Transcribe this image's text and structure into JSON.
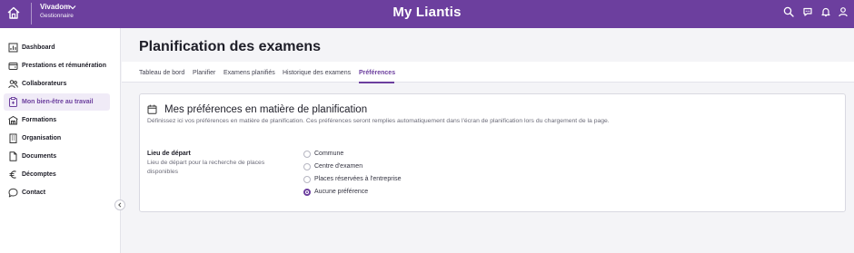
{
  "header": {
    "company": "Vivadom",
    "role": "Gestionnaire",
    "title": "My Liantis"
  },
  "sidebar": {
    "items": [
      {
        "label": "Dashboard",
        "icon": "chart-icon"
      },
      {
        "label": "Prestations et rémunération",
        "icon": "wallet-icon"
      },
      {
        "label": "Collaborateurs",
        "icon": "people-icon"
      },
      {
        "label": "Mon bien-être au travail",
        "icon": "clipboard-icon",
        "active": true
      },
      {
        "label": "Formations",
        "icon": "school-icon"
      },
      {
        "label": "Organisation",
        "icon": "building-icon"
      },
      {
        "label": "Documents",
        "icon": "document-icon"
      },
      {
        "label": "Décomptes",
        "icon": "euro-icon"
      },
      {
        "label": "Contact",
        "icon": "chat-icon"
      }
    ]
  },
  "main": {
    "page_title": "Planification des examens",
    "tabs": [
      {
        "label": "Tableau de bord"
      },
      {
        "label": "Planifier"
      },
      {
        "label": "Examens planifiés"
      },
      {
        "label": "Historique des examens"
      },
      {
        "label": "Préférences",
        "active": true
      }
    ],
    "card": {
      "title": "Mes préférences en matière de planification",
      "description": "Définissez ici vos préférences en matière de planification. Ces préférences seront remplies automatiquement dans l'écran de planification lors du chargement de la page.",
      "field_label": "Lieu de départ",
      "field_help": "Lieu de départ pour la recherche de places disponibles",
      "options": [
        {
          "label": "Commune",
          "selected": false
        },
        {
          "label": "Centre d'examen",
          "selected": false
        },
        {
          "label": "Places réservées à l'entreprise",
          "selected": false
        },
        {
          "label": "Aucune préférence",
          "selected": true
        }
      ]
    }
  },
  "colors": {
    "brand": "#6c3f9e",
    "active_bg": "#f0ebf7"
  }
}
